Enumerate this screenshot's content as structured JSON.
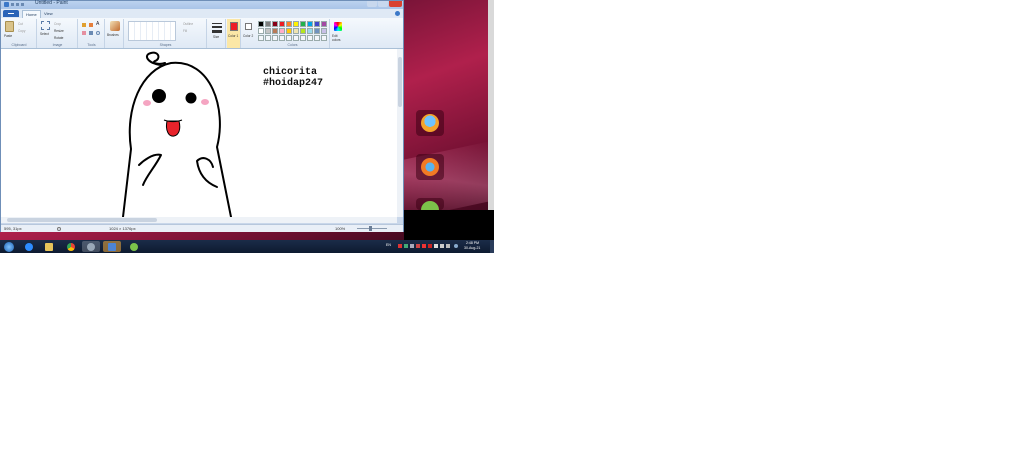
{
  "window": {
    "title": "Untitled - Paint",
    "tabs": {
      "file": "",
      "home": "Home",
      "view": "View"
    }
  },
  "ribbon": {
    "clipboard": {
      "paste": "Paste",
      "cut": "Cut",
      "copy": "Copy",
      "label": "Clipboard"
    },
    "image": {
      "select": "Select",
      "crop": "Crop",
      "resize": "Resize",
      "rotate": "Rotate",
      "label": "Image"
    },
    "tools": {
      "label": "Tools"
    },
    "brushes": {
      "label": "Brushes"
    },
    "shapes": {
      "outline": "Outline",
      "fill": "Fill",
      "label": "Shapes"
    },
    "size": {
      "label": "Size"
    },
    "color1": {
      "label": "Color 1"
    },
    "color2": {
      "label": "Color 2"
    },
    "colors": {
      "label": "Colors"
    },
    "edit_colors": {
      "label": "Edit colors"
    },
    "palette": [
      "#000000",
      "#7f7f7f",
      "#880015",
      "#ed1c24",
      "#ff7f27",
      "#fff200",
      "#22b14c",
      "#00a2e8",
      "#3f48cc",
      "#a349a4",
      "#ffffff",
      "#c3c3c3",
      "#b97a57",
      "#ffaec9",
      "#ffc90e",
      "#efe4b0",
      "#b5e61d",
      "#99d9ea",
      "#7092be",
      "#c8bfe7"
    ]
  },
  "canvas": {
    "text_line1": "chicorita",
    "text_line2": "#hoidap247"
  },
  "status": {
    "cursor_pos": "595, 31px",
    "image_size": "1024 × 1376px",
    "zoom": "100%"
  },
  "taskbar": {
    "lang": "EN",
    "time": "2:48 PM",
    "date": "30-Aug-21"
  },
  "colors": {
    "accent": "#2a64b8",
    "desktop": "#b0204c"
  }
}
